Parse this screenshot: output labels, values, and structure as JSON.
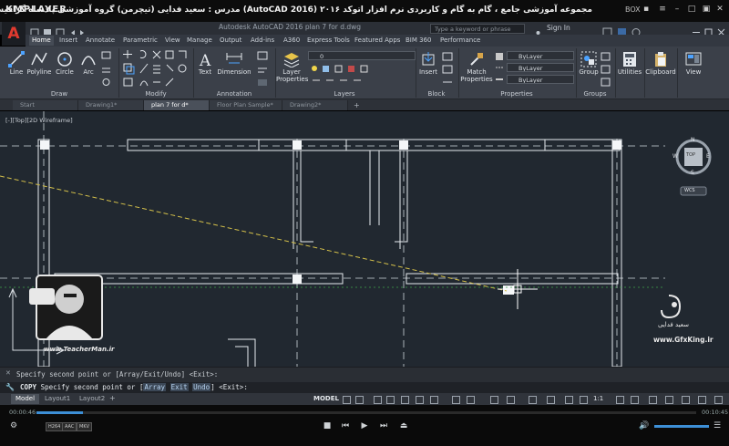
{
  "player": {
    "logo": "KMPLAYER",
    "title": "مجموعه آموزشی جامع ، گام به گام و کاربردی نرم افزار اتوکد ۲۰۱۶ (AutoCAD 2016) مدرس : سعید فدایی (تیچرمن) گروه آموزشی پادشاه گرافیست ها",
    "box_label": "BOX",
    "time_elapsed": "00:00:46",
    "time_total": "00:10:45",
    "progress": 0.07,
    "badges": [
      "H264",
      "AAC",
      "MKV"
    ]
  },
  "acad": {
    "logo": "A",
    "title": "Autodesk AutoCAD 2016   plan 7 for d.dwg",
    "search_placeholder": "Type a keyword or phrase",
    "signin": "Sign In"
  },
  "ribbon_tabs": [
    "Home",
    "Insert",
    "Annotate",
    "Parametric",
    "View",
    "Manage",
    "Output",
    "Add-ins",
    "A360",
    "Express Tools",
    "Featured Apps",
    "BIM 360",
    "Performance"
  ],
  "ribbon": {
    "draw": {
      "title": "Draw",
      "tools": [
        "Line",
        "Polyline",
        "Circle",
        "Arc"
      ]
    },
    "modify": {
      "title": "Modify"
    },
    "annotation": {
      "title": "Annotation",
      "tools": [
        "Text",
        "Dimension"
      ]
    },
    "layers": {
      "title": "Layers",
      "tool": "Layer Properties",
      "layer_value": "0"
    },
    "block": {
      "title": "Block",
      "tool": "Insert"
    },
    "properties": {
      "title": "Properties",
      "tool": "Match Properties",
      "bylayer1": "ByLayer",
      "bylayer2": "ByLayer",
      "bylayer3": "ByLayer"
    },
    "groups": {
      "title": "Groups",
      "tool": "Group"
    },
    "utilities": {
      "tool": "Utilities"
    },
    "clipboard": {
      "tool": "Clipboard"
    },
    "view": {
      "tool": "View"
    }
  },
  "doc_tabs": [
    "Start",
    "Drawing1*",
    "plan 7 for d*",
    "Floor Plan Sample*",
    "Drawing2*"
  ],
  "viewport_label": "[-][Top][2D Wireframe]",
  "viewcube": {
    "top": "TOP",
    "n": "N",
    "s": "S",
    "e": "E",
    "w": "W",
    "wcs": "WCS"
  },
  "command": {
    "history": "Specify second point or [Array/Exit/Undo] <Exit>:",
    "prefix": "COPY",
    "prompt": "Specify second point or [",
    "options": [
      "Array",
      "Exit",
      "Undo"
    ],
    "suffix": "] <Exit>:"
  },
  "layout_tabs": [
    "Model",
    "Layout1",
    "Layout2"
  ],
  "status": {
    "model": "MODEL",
    "scale": "1:1"
  },
  "watermark": {
    "teacher_url": "www.TeacherMan.ir",
    "gfx_url": "www.GfxKing.ir",
    "gfx_name": "سعید فدایی"
  },
  "colors": {
    "canvas": "#212830",
    "ribbon": "#3b4049",
    "accent": "#3d8fd6"
  }
}
